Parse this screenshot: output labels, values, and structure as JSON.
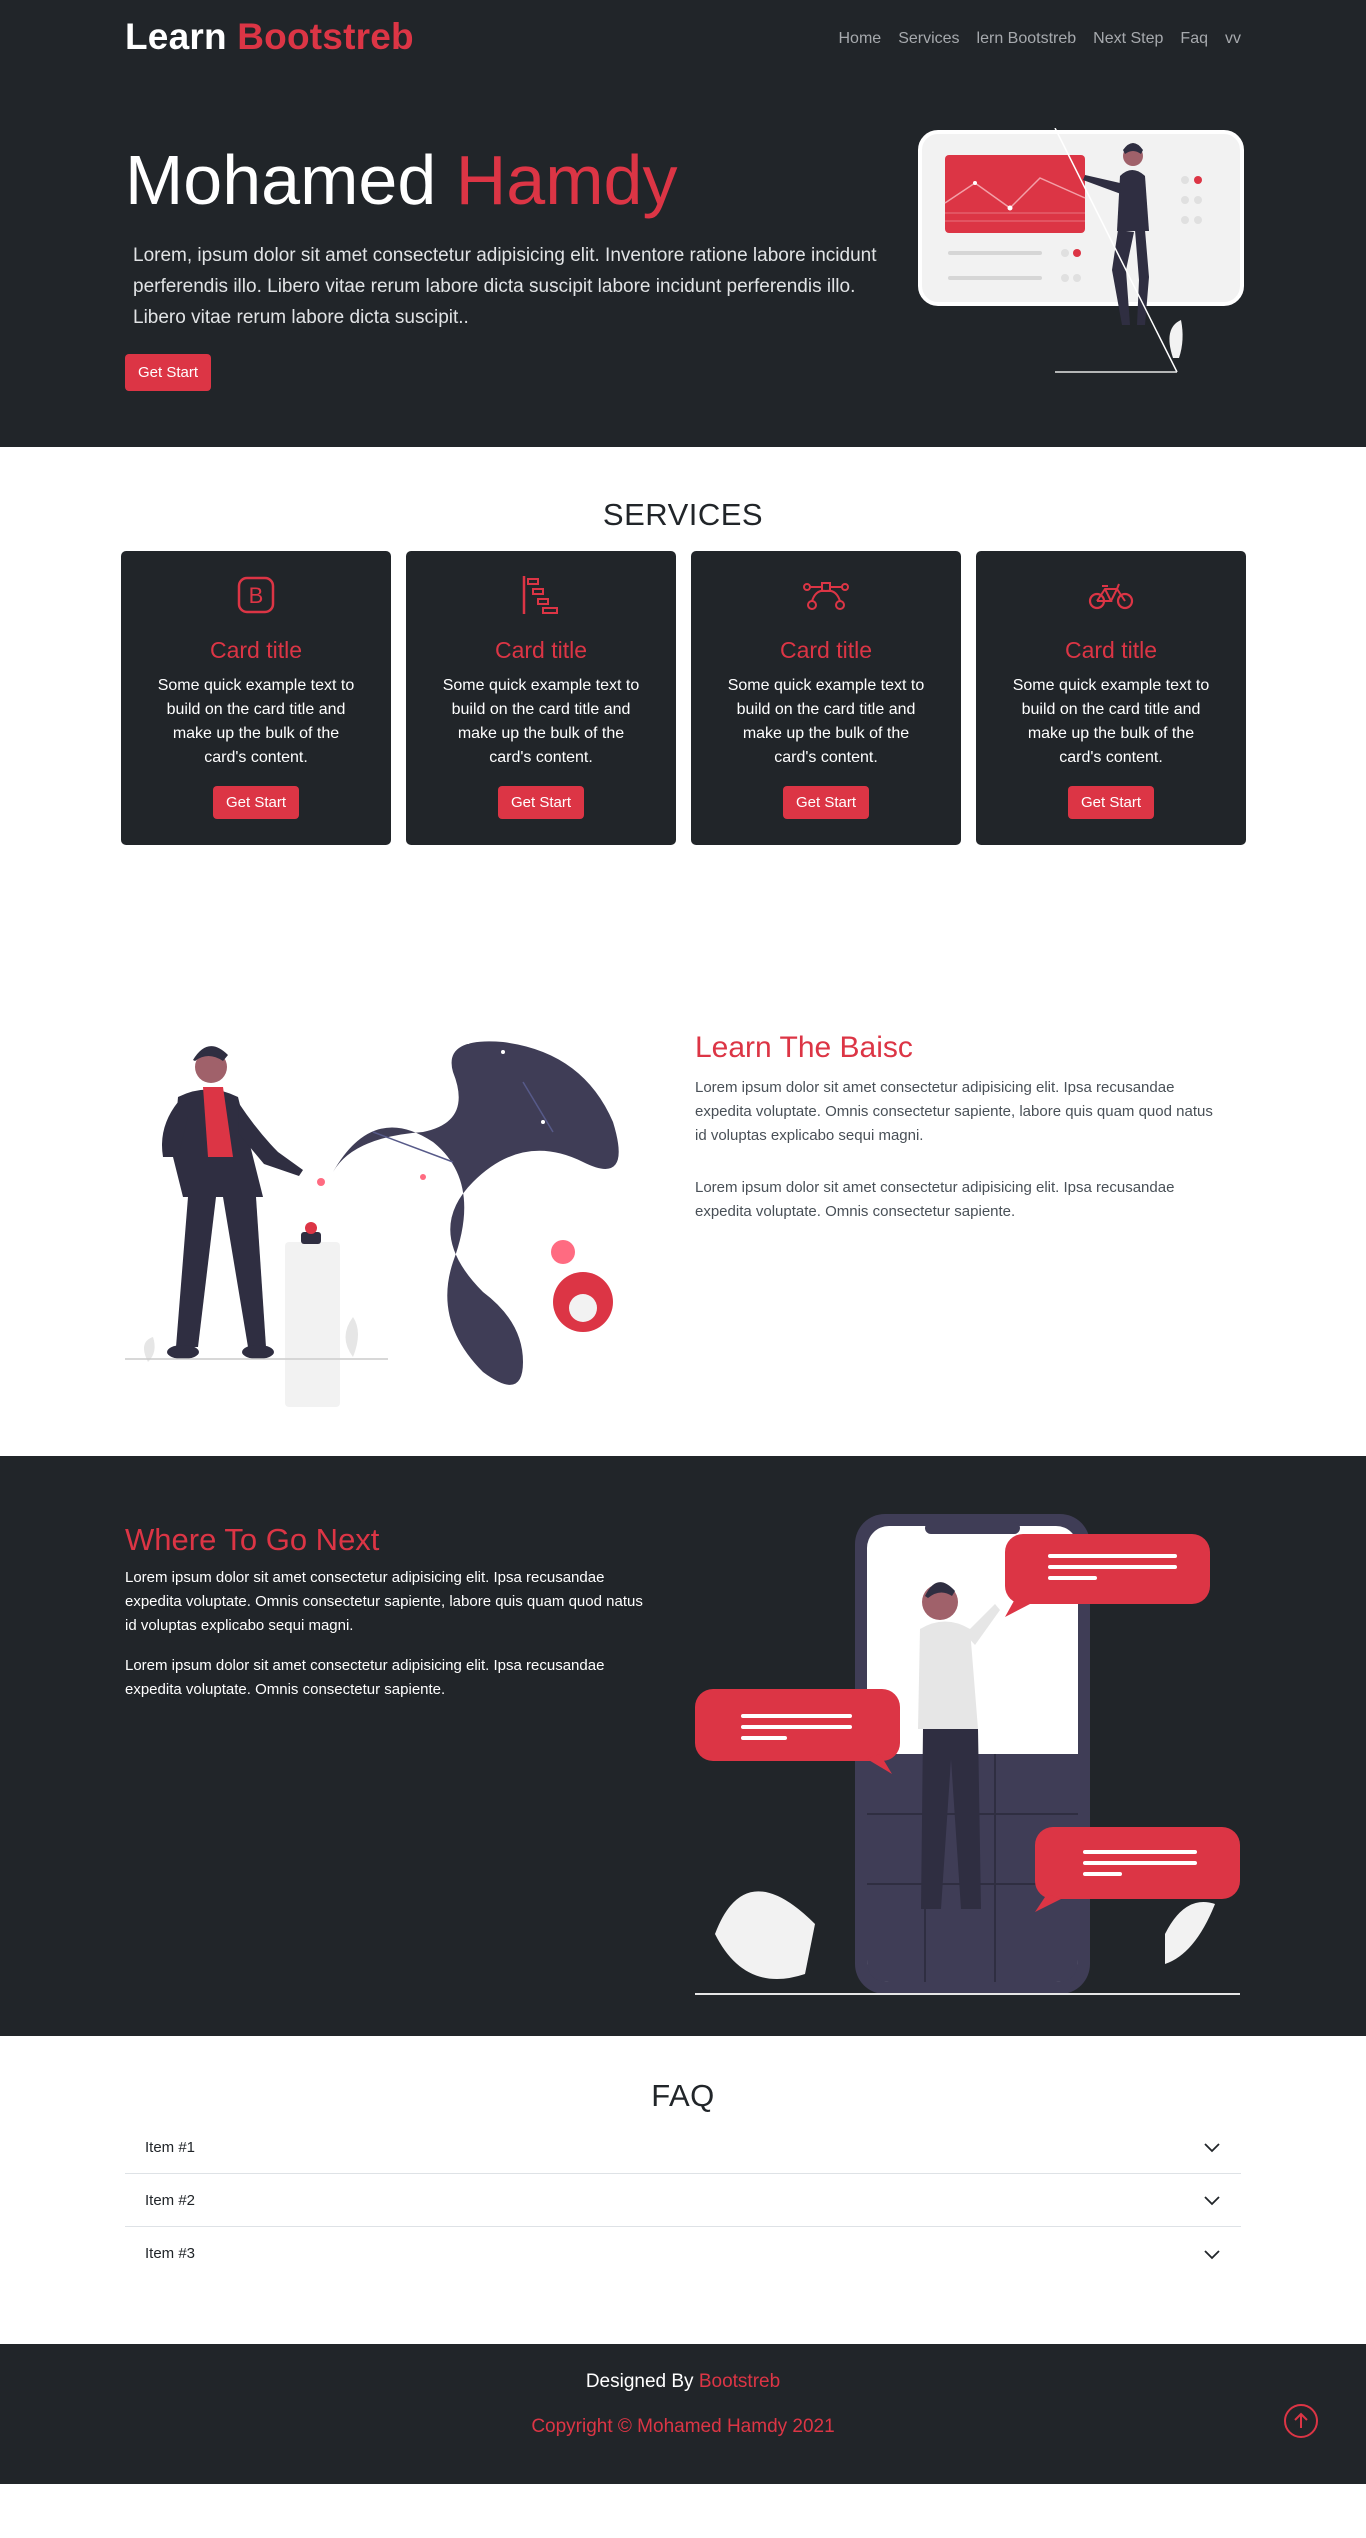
{
  "header": {
    "brand_first": "Learn",
    "brand_second": "Bootstreb",
    "nav": [
      "Home",
      "Services",
      "lern Bootstreb",
      "Next Step",
      "Faq",
      "vv"
    ]
  },
  "hero": {
    "title_first": "Mohamed",
    "title_second": "Hamdy",
    "text": "Lorem, ipsum dolor sit amet consectetur adipisicing elit. Inventore ratione labore incidunt perferendis illo. Libero vitae rerum labore dicta suscipit labore incidunt perferendis illo. Libero vitae rerum labore dicta suscipit..",
    "button": "Get Start"
  },
  "services": {
    "title": "SERVICES",
    "cards": [
      {
        "icon": "bootstrap-icon",
        "title": "Card title",
        "text": "Some quick example text to build on the card title and make up the bulk of the card's content.",
        "button": "Get Start"
      },
      {
        "icon": "bar-chart-steps-icon",
        "title": "Card title",
        "text": "Some quick example text to build on the card title and make up the bulk of the card's content.",
        "button": "Get Start"
      },
      {
        "icon": "bezier-icon",
        "title": "Card title",
        "text": "Some quick example text to build on the card title and make up the bulk of the card's content.",
        "button": "Get Start"
      },
      {
        "icon": "bicycle-icon",
        "title": "Card title",
        "text": "Some quick example text to build on the card title and make up the bulk of the card's content.",
        "button": "Get Start"
      }
    ]
  },
  "learn": {
    "title": "Learn The Baisc",
    "p1": "Lorem ipsum dolor sit amet consectetur adipisicing elit. Ipsa recusandae expedita voluptate. Omnis consectetur sapiente, labore quis quam quod natus id voluptas explicabo sequi magni.",
    "p2": "Lorem ipsum dolor sit amet consectetur adipisicing elit. Ipsa recusandae expedita voluptate. Omnis consectetur sapiente."
  },
  "next": {
    "title": "Where To Go Next",
    "p1": "Lorem ipsum dolor sit amet consectetur adipisicing elit. Ipsa recusandae expedita voluptate. Omnis consectetur sapiente, labore quis quam quod natus id voluptas explicabo sequi magni.",
    "p2": "Lorem ipsum dolor sit amet consectetur adipisicing elit. Ipsa recusandae expedita voluptate. Omnis consectetur sapiente."
  },
  "faq": {
    "title": "FAQ",
    "items": [
      "Item #1",
      "Item #2",
      "Item #3"
    ]
  },
  "footer": {
    "designed_by": "Designed By",
    "designed_link": "Bootstreb",
    "copyright": "Copyright © Mohamed Hamdy 2021"
  },
  "colors": {
    "accent": "#dc3545",
    "dark": "#212529"
  }
}
